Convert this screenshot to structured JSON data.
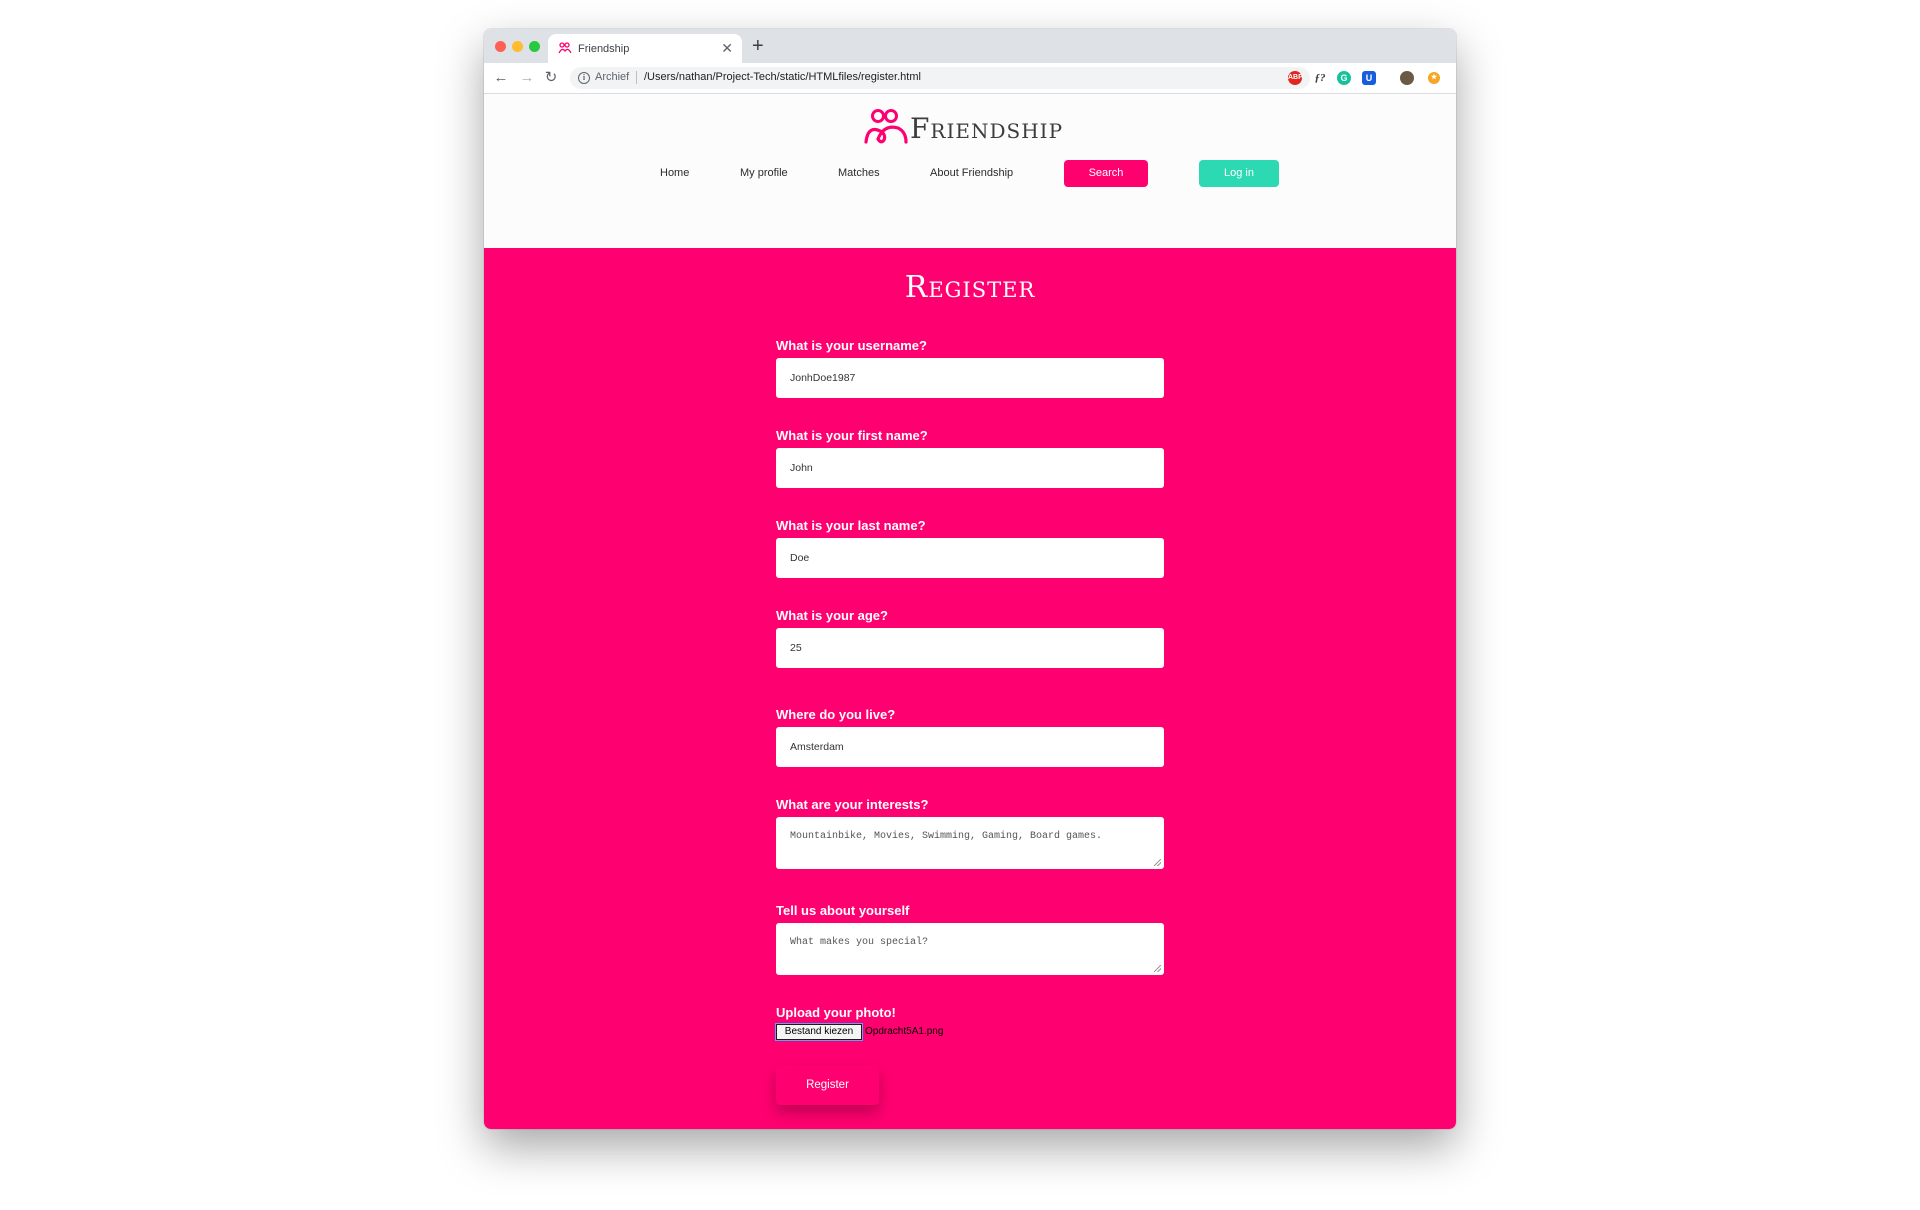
{
  "browser": {
    "tab_title": "Friendship",
    "omnibox_label": "Archief",
    "url": "/Users/nathan/Project-Tech/static/HTMLfiles/register.html"
  },
  "site": {
    "logo_text": "Friendship",
    "nav": {
      "home": "Home",
      "profile": "My profile",
      "matches": "Matches",
      "about": "About Friendship",
      "search": "Search",
      "login": "Log in"
    }
  },
  "register": {
    "title": "Register",
    "fields": {
      "username": {
        "label": "What is your username?",
        "value": "JonhDoe1987"
      },
      "first_name": {
        "label": "What is your first name?",
        "value": "John"
      },
      "last_name": {
        "label": "What is your last name?",
        "value": "Doe"
      },
      "age": {
        "label": "What is your age?",
        "value": "25"
      },
      "location": {
        "label": "Where do you live?",
        "value": "Amsterdam"
      },
      "interests": {
        "label": "What are your interests?",
        "placeholder": "Mountainbike, Movies, Swimming, Gaming, Board games."
      },
      "about": {
        "label": "Tell us about yourself",
        "placeholder": "What makes you special?"
      },
      "photo": {
        "label": "Upload your photo!",
        "button": "Bestand kiezen",
        "file_name": "Opdracht5A1.png"
      }
    },
    "submit": "Register"
  },
  "colors": {
    "brand_pink": "#ff0070",
    "login_teal": "#2dd9b3"
  }
}
